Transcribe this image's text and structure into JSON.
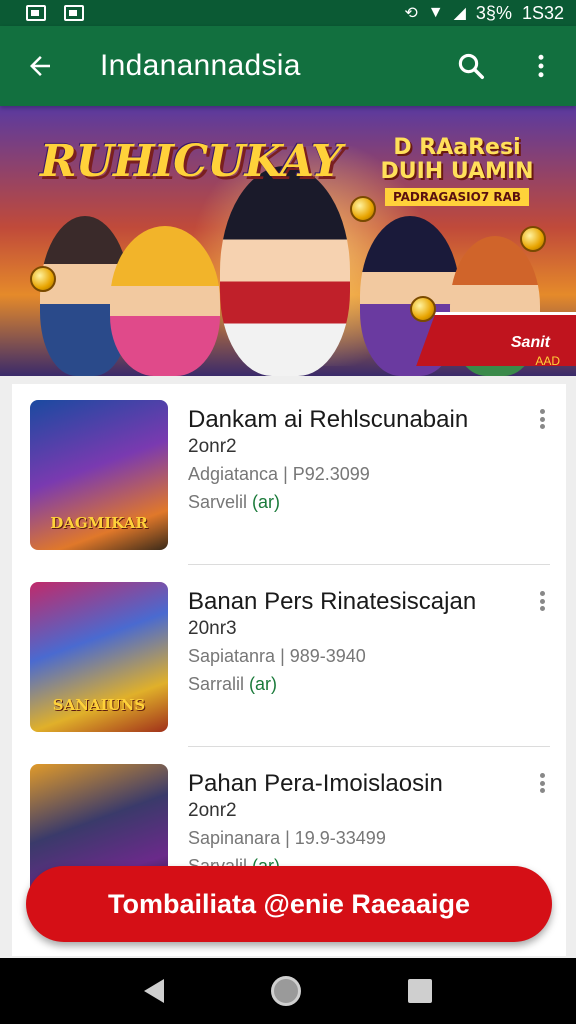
{
  "status_bar": {
    "battery": "3§%",
    "time": "1S32",
    "icons": [
      "gallery-icon",
      "image-icon",
      "sync-icon",
      "wifi-icon",
      "signal-icon"
    ]
  },
  "app_bar": {
    "title": "Indanannadsia",
    "back_icon": "arrow-left-icon",
    "search_icon": "search-icon",
    "more_icon": "more-vert-icon"
  },
  "banner": {
    "title": "RUHICUKAY",
    "promo_line1": "D RAaResi",
    "promo_line2": "DUIH UAMIN",
    "promo_sub": "PADRAGASIO7 RAB",
    "ribbon_text": "Sanit",
    "mark": "AAD"
  },
  "list": {
    "items": [
      {
        "title": "Dankam ai Rehlscunabain",
        "year": "2onr2",
        "meta": "Adgiatanca | P92.3099",
        "status_prefix": "Sarvelil",
        "status_tag": "(ar)",
        "thumb_caption": "DAGMIKAR"
      },
      {
        "title": "Banan Pers Rinatesiscajan",
        "year": "20nr3",
        "meta": "Sapiatanra | 989-3940",
        "status_prefix": "Sarralil",
        "status_tag": "(ar)",
        "thumb_caption": "SANAIUNS"
      },
      {
        "title": "Pahan Pera-Imoislaosin",
        "year": "2onr2",
        "meta": "Sapinanara | 19.9-33499",
        "status_prefix": "Sarvalil",
        "status_tag": "(ar)",
        "thumb_caption": ""
      }
    ]
  },
  "cta": {
    "label": "Tombailiata @enie Raeaaige"
  },
  "nav_bar": {
    "back_icon": "nav-back-icon",
    "home_icon": "nav-home-icon",
    "recent_icon": "nav-recent-icon"
  },
  "colors": {
    "status_bar": "#0b5a34",
    "app_bar": "#12703f",
    "cta": "#d50f16",
    "status_tag": "#1a7a3a"
  }
}
